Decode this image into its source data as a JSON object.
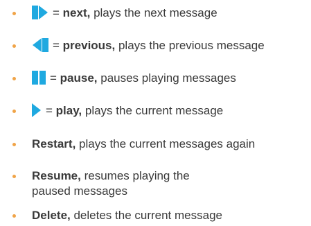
{
  "colors": {
    "bullet": "#f0a448",
    "icon": "#1fa9e0",
    "text": "#3a3a3a"
  },
  "items": [
    {
      "icon": "next-icon",
      "eq": "= ",
      "term": "next,",
      "desc": " plays the next message"
    },
    {
      "icon": "previous-icon",
      "eq": "= ",
      "term": "previous,",
      "desc": " plays the previous message"
    },
    {
      "icon": "pause-icon",
      "eq": "= ",
      "term": "pause,",
      "desc": " pauses playing messages"
    },
    {
      "icon": "play-icon",
      "eq": "= ",
      "term": "play,",
      "desc": " plays the current message"
    },
    {
      "term": "Restart,",
      "desc": " plays the current messages again"
    },
    {
      "term": "Resume,",
      "desc": " resumes playing the",
      "desc2": "paused messages"
    },
    {
      "term": "Delete,",
      "desc": " deletes the current message"
    }
  ]
}
